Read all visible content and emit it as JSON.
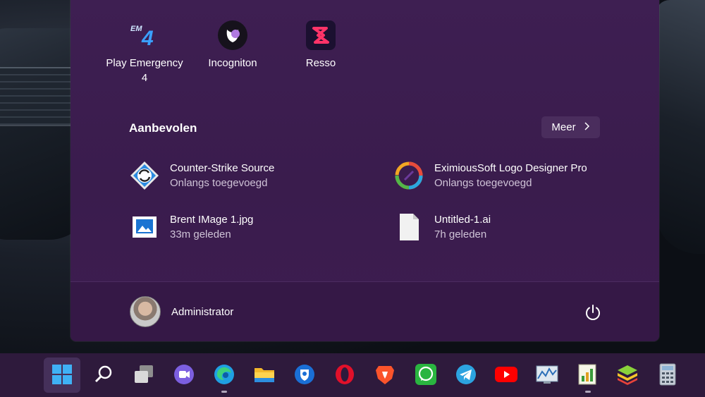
{
  "pinned_apps": [
    {
      "label": "Play Emergency\n4",
      "line1": "Play Emergency",
      "line2": "4",
      "icon": "emergency-4-icon"
    },
    {
      "label": "Incogniton",
      "icon": "incogniton-icon"
    },
    {
      "label": "Resso",
      "icon": "resso-icon"
    }
  ],
  "recommended": {
    "title": "Aanbevolen",
    "more_label": "Meer",
    "items": [
      {
        "name": "Counter-Strike Source",
        "sub": "Onlangs toegevoegd",
        "icon": "steam-update-icon"
      },
      {
        "name": "EximiousSoft Logo Designer Pro",
        "sub": "Onlangs toegevoegd",
        "icon": "logo-designer-icon"
      },
      {
        "name": "Brent IMage 1.jpg",
        "sub": "33m geleden",
        "icon": "image-file-icon"
      },
      {
        "name": "Untitled-1.ai",
        "sub": "7h geleden",
        "icon": "document-file-icon"
      }
    ]
  },
  "user": {
    "name": "Administrator"
  },
  "taskbar": [
    "windows-start-icon",
    "search-icon",
    "task-view-icon",
    "chat-icon",
    "edge-icon",
    "file-explorer-icon",
    "bitwarden-icon",
    "opera-icon",
    "brave-icon",
    "whatsapp-icon",
    "telegram-icon",
    "youtube-icon",
    "performance-monitor-icon",
    "spreadsheet-icon",
    "bluestacks-icon",
    "calculator-icon"
  ],
  "colors": {
    "panel": "#3e1f52",
    "footer": "#351846",
    "taskbar": "#2e1a3c",
    "accent": "#0078d4"
  }
}
